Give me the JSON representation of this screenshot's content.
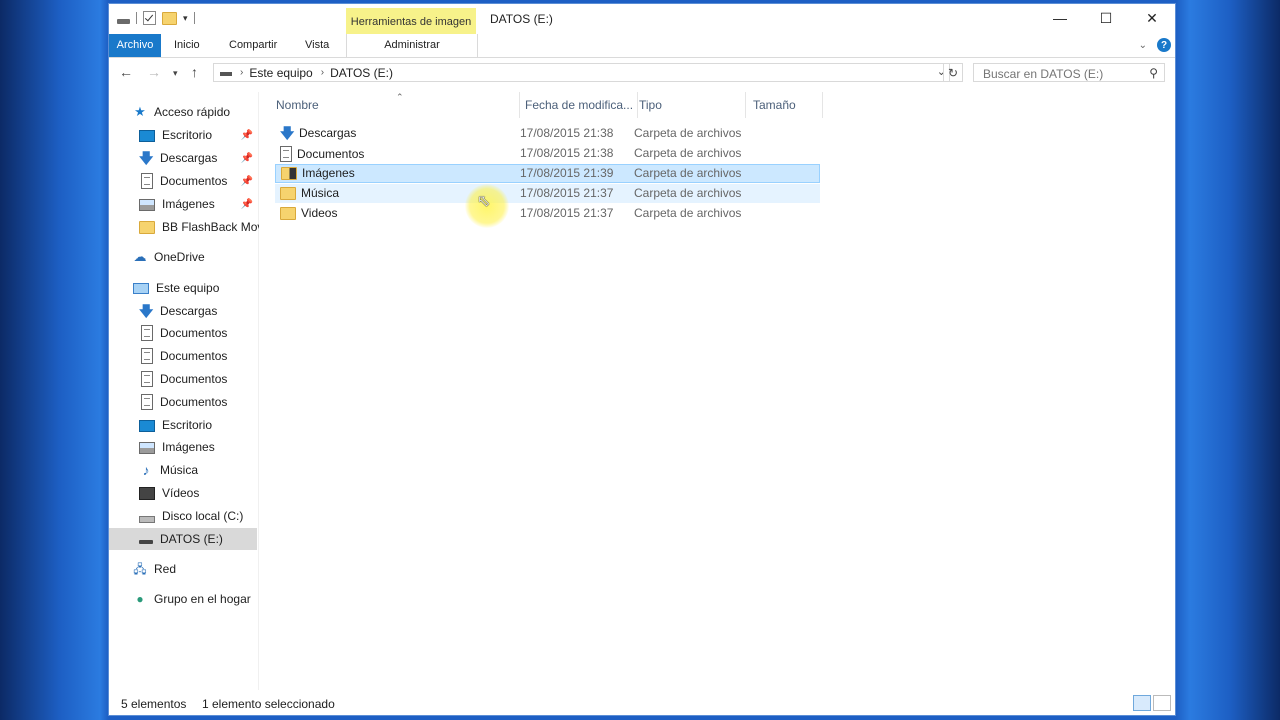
{
  "window": {
    "title": "DATOS (E:)"
  },
  "ribbon": {
    "context_tab": "Herramientas de imagen",
    "tabs": [
      "Archivo",
      "Inicio",
      "Compartir",
      "Vista"
    ],
    "context_subtab": "Administrar",
    "help": "?"
  },
  "address": {
    "crumbs": [
      "Este equipo",
      "DATOS (E:)"
    ],
    "search_placeholder": "Buscar en DATOS (E:)"
  },
  "nav_pane": {
    "items": [
      {
        "label": "Acceso rápido",
        "icon": "star-icon",
        "pinned": false
      },
      {
        "label": "Escritorio",
        "icon": "desktop-icon",
        "pinned": true
      },
      {
        "label": "Descargas",
        "icon": "download-icon",
        "pinned": true
      },
      {
        "label": "Documentos",
        "icon": "document-icon",
        "pinned": true
      },
      {
        "label": "Imágenes",
        "icon": "pictures-icon",
        "pinned": true
      },
      {
        "label": "BB FlashBack Movie",
        "icon": "folder-icon",
        "pinned": false
      },
      {
        "label": "OneDrive",
        "icon": "cloud-icon",
        "pinned": false
      },
      {
        "label": "Este equipo",
        "icon": "computer-icon",
        "pinned": false
      },
      {
        "label": "Descargas",
        "icon": "download-icon",
        "pinned": false
      },
      {
        "label": "Documentos",
        "icon": "document-icon",
        "pinned": false
      },
      {
        "label": "Documentos",
        "icon": "document-icon",
        "pinned": false
      },
      {
        "label": "Documentos",
        "icon": "document-icon",
        "pinned": false
      },
      {
        "label": "Documentos",
        "icon": "document-icon",
        "pinned": false
      },
      {
        "label": "Escritorio",
        "icon": "desktop-icon",
        "pinned": false
      },
      {
        "label": "Imágenes",
        "icon": "pictures-icon",
        "pinned": false
      },
      {
        "label": "Música",
        "icon": "music-icon",
        "pinned": false
      },
      {
        "label": "Vídeos",
        "icon": "video-icon",
        "pinned": false
      },
      {
        "label": "Disco local (C:)",
        "icon": "drive-icon",
        "pinned": false
      },
      {
        "label": "DATOS (E:)",
        "icon": "drive-icon",
        "pinned": false,
        "selected": true
      },
      {
        "label": "Red",
        "icon": "network-icon",
        "pinned": false
      },
      {
        "label": "Grupo en el hogar",
        "icon": "homegroup-icon",
        "pinned": false
      }
    ]
  },
  "file_list": {
    "columns": [
      "Nombre",
      "Fecha de modifica...",
      "Tipo",
      "Tamaño"
    ],
    "rows": [
      {
        "name": "Descargas",
        "date": "17/08/2015 21:38",
        "type": "Carpeta de archivos",
        "icon": "download-icon"
      },
      {
        "name": "Documentos",
        "date": "17/08/2015 21:38",
        "type": "Carpeta de archivos",
        "icon": "document-icon"
      },
      {
        "name": "Imágenes",
        "date": "17/08/2015 21:39",
        "type": "Carpeta de archivos",
        "icon": "pictures-folder-icon",
        "selected": true
      },
      {
        "name": "Música",
        "date": "17/08/2015 21:37",
        "type": "Carpeta de archivos",
        "icon": "folder-icon",
        "hover": true
      },
      {
        "name": "Videos",
        "date": "17/08/2015 21:37",
        "type": "Carpeta de archivos",
        "icon": "folder-icon"
      }
    ]
  },
  "status": {
    "count": "5 elementos",
    "selection": "1 elemento seleccionado"
  },
  "colors": {
    "accent": "#1979ca",
    "context_tab": "#f7f28a",
    "selection": "#cce8ff"
  }
}
